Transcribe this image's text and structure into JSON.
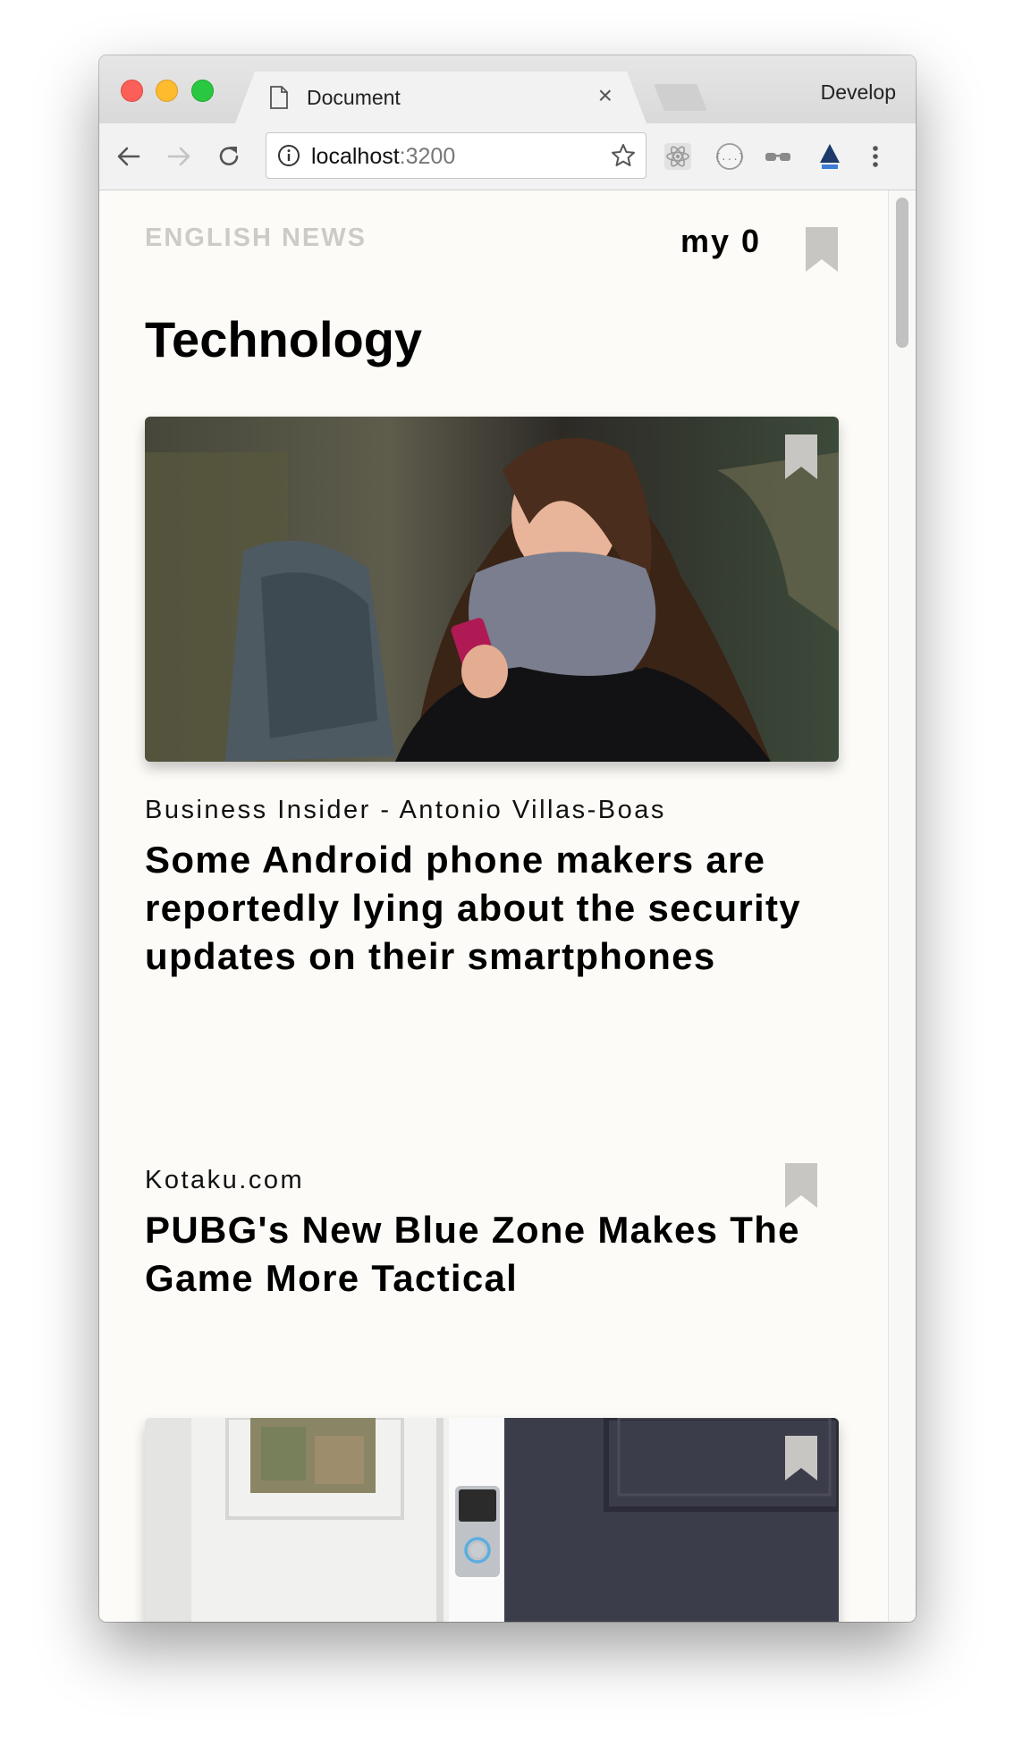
{
  "browser": {
    "tab_title": "Document",
    "tab_close": "×",
    "profile_label": "Develop",
    "url_host": "localhost",
    "url_port": ":3200"
  },
  "header": {
    "site_name": "ENGLISH NEWS",
    "my_count": "my 0"
  },
  "page_title": "Technology",
  "articles": [
    {
      "source": "Business Insider - Antonio Villas-Boas",
      "headline": "Some Android phone makers are reportedly lying about the security updates on their smartphones",
      "has_image": true
    },
    {
      "source": "Kotaku.com",
      "headline": "PUBG's New Blue Zone Makes The Game More Tactical",
      "has_image": false
    },
    {
      "has_image": true
    }
  ],
  "icons": {
    "back": "arrow-left",
    "forward": "arrow-right",
    "reload": "reload",
    "info": "info-circle",
    "bookmark_star": "star",
    "extensions": [
      "react-devtools",
      "json-viewer",
      "glasses",
      "axe"
    ],
    "menu": "vertical-dots",
    "bookmark": "bookmark-ribbon"
  },
  "colors": {
    "page_background": "#fcfbf7",
    "site_name": "#cdcbc7",
    "bookmark": "#c8c6c2",
    "text": "#000000"
  }
}
